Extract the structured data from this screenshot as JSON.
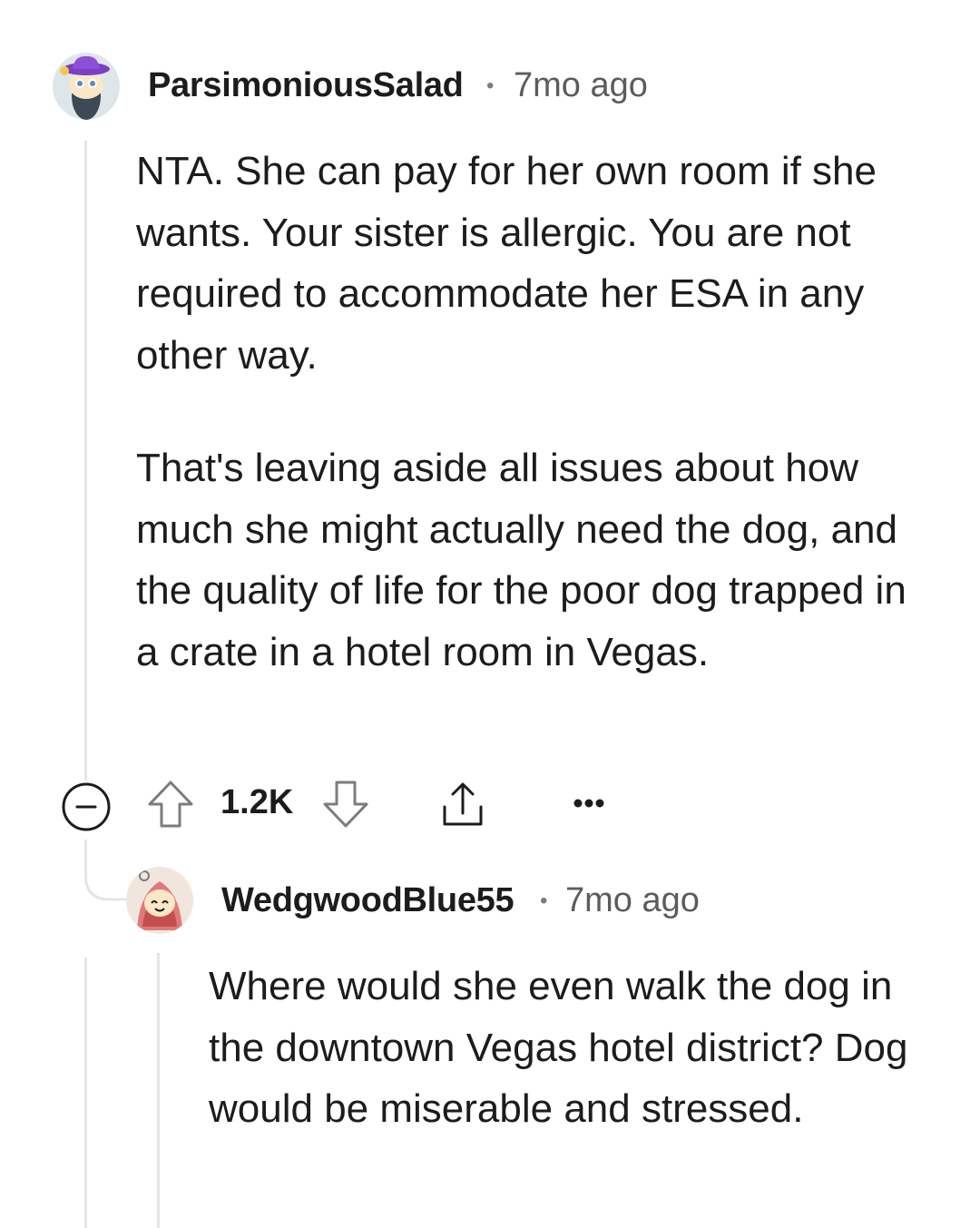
{
  "comments": [
    {
      "author": "ParsimoniousSalad",
      "separator": "•",
      "age": "7mo ago",
      "paragraphs": [
        "NTA. She can pay for her own room if she wants. Your sister is allergic. You are not required to accommodate her ESA in any other way.",
        "That's leaving aside all issues about how much she might actually need the dog, and the quality of life for the poor dog trapped in a crate in a hotel room in Vegas."
      ],
      "actions": {
        "collapse_icon": "minus-circle-icon",
        "upvote_icon": "upvote-arrow-icon",
        "score": "1.2K",
        "downvote_icon": "downvote-arrow-icon",
        "share_icon": "share-icon",
        "more_icon": "more-dots-icon"
      }
    },
    {
      "author": "WedgwoodBlue55",
      "separator": "•",
      "age": "7mo ago",
      "paragraphs": [
        "Where would she even walk the dog in the downtown Vegas hotel district? Dog would be miserable and stressed."
      ]
    }
  ],
  "colors": {
    "text": "#1c1c1c",
    "meta": "#5c5c5c",
    "thread_line": "#e3e5e7",
    "icon": "#1c1c1c"
  }
}
